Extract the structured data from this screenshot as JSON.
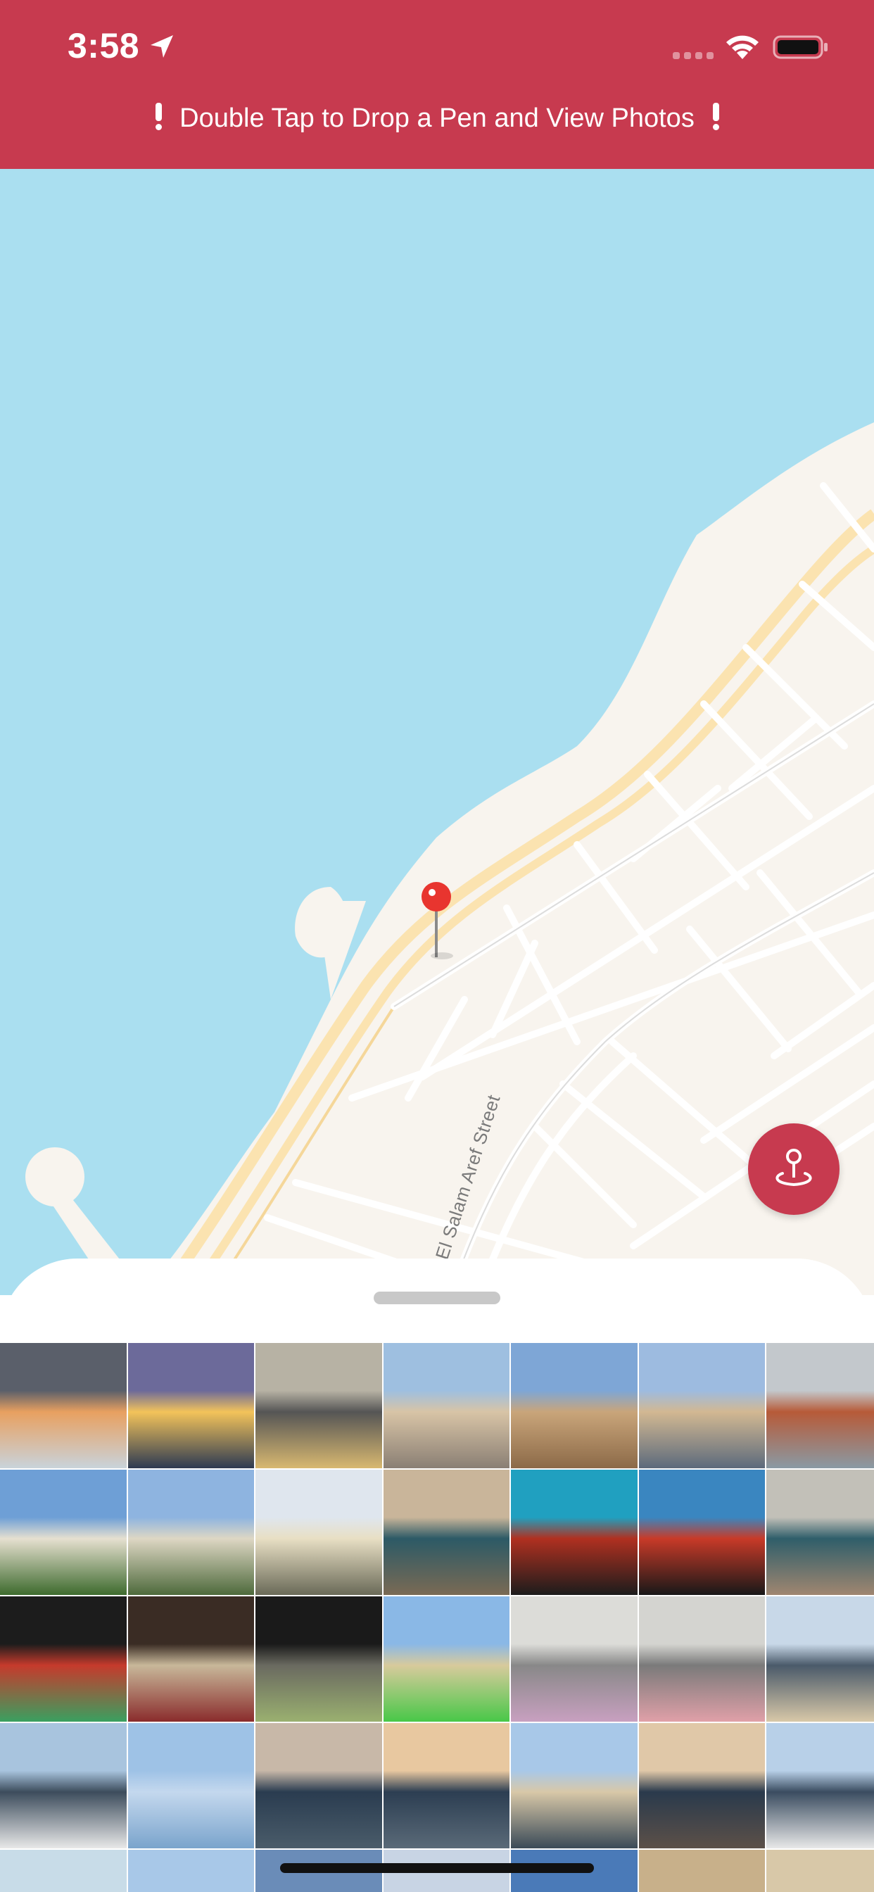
{
  "theme": {
    "accent": "#c73a4f",
    "water": "#aadff0",
    "land": "#f8f4ee",
    "road": "#ffffff",
    "highway": "#fbe3b0",
    "pin": "#e8352f"
  },
  "status_bar": {
    "time": "3:58",
    "location_icon": "location-arrow-icon",
    "wifi_icon": "wifi-icon",
    "battery_icon": "battery-icon"
  },
  "banner": {
    "text": "Double Tap to Drop a Pen and View Photos",
    "left_icon": "exclamation-icon",
    "right_icon": "exclamation-icon"
  },
  "map": {
    "street_label": "Abd El Salam Aref Street",
    "pin_icon": "map-pin-icon"
  },
  "locate_button": {
    "icon": "location-pin-icon"
  },
  "photos": [
    {
      "subject": "sea waves at dusk",
      "palette": [
        "#5a5f6a",
        "#e8a060",
        "#c9d3db"
      ]
    },
    {
      "subject": "sunset over sea",
      "palette": [
        "#6c6a9a",
        "#f3c35a",
        "#2d3a52"
      ]
    },
    {
      "subject": "corniche street",
      "palette": [
        "#b7b2a4",
        "#555555",
        "#d8b870"
      ]
    },
    {
      "subject": "apartment towers",
      "palette": [
        "#9ebfe0",
        "#d8c4a6",
        "#8a7f74"
      ]
    },
    {
      "subject": "tall buildings",
      "palette": [
        "#7ea6d6",
        "#c9a57a",
        "#8c6a48"
      ]
    },
    {
      "subject": "hotel building",
      "palette": [
        "#9dbbe0",
        "#d2b892",
        "#5c6a7c"
      ]
    },
    {
      "subject": "rain on window",
      "palette": [
        "#c3c8cc",
        "#b75a38",
        "#8a9aa4"
      ]
    },
    {
      "subject": "palace garden",
      "palette": [
        "#6e9fd6",
        "#e6e0d0",
        "#3e6b2e"
      ]
    },
    {
      "subject": "palace facade",
      "palette": [
        "#8eb4e0",
        "#ded7c4",
        "#4e6a3c"
      ]
    },
    {
      "subject": "villa facade",
      "palette": [
        "#dfe6ee",
        "#e8dfc4",
        "#6a6a58"
      ]
    },
    {
      "subject": "jewelry display",
      "palette": [
        "#c9b59a",
        "#2c5a66",
        "#7a6a54"
      ]
    },
    {
      "subject": "stained glass",
      "palette": [
        "#20a0c0",
        "#b03020",
        "#1c1c1c"
      ]
    },
    {
      "subject": "stained glass",
      "palette": [
        "#3a86c0",
        "#c83a28",
        "#181818"
      ]
    },
    {
      "subject": "jewelry display",
      "palette": [
        "#c2c0b8",
        "#2f5e6a",
        "#a08670"
      ]
    },
    {
      "subject": "stained glass",
      "palette": [
        "#1c1c1c",
        "#c63a2c",
        "#3aa060"
      ]
    },
    {
      "subject": "palace interior",
      "palette": [
        "#3a2c24",
        "#c8b89a",
        "#8a2c2c"
      ]
    },
    {
      "subject": "window interior",
      "palette": [
        "#1a1a1a",
        "#6a6a60",
        "#9ab070"
      ]
    },
    {
      "subject": "villa with toy",
      "palette": [
        "#8ab8e6",
        "#d8ca9c",
        "#48c848"
      ]
    },
    {
      "subject": "market roof",
      "palette": [
        "#dcdcd8",
        "#888888",
        "#c8a0c0"
      ]
    },
    {
      "subject": "market mural",
      "palette": [
        "#d4d4d0",
        "#7a7a7a",
        "#e0a0a8"
      ]
    },
    {
      "subject": "harbor view",
      "palette": [
        "#c8d8e8",
        "#4a5a6a",
        "#d8c8a8"
      ]
    },
    {
      "subject": "boats in bay",
      "palette": [
        "#a8c4de",
        "#3c4c5c",
        "#e8e8e8"
      ]
    },
    {
      "subject": "clear sky",
      "palette": [
        "#9ec2e6",
        "#c4d8ee",
        "#7aa4cc"
      ]
    },
    {
      "subject": "sea rocks",
      "palette": [
        "#c8b8a8",
        "#2a3c50",
        "#4a5c6a"
      ]
    },
    {
      "subject": "calm sea",
      "palette": [
        "#e8c8a0",
        "#2c3e52",
        "#5a6a78"
      ]
    },
    {
      "subject": "harbor towers",
      "palette": [
        "#a8c8e8",
        "#d8c8a8",
        "#3a4a58"
      ]
    },
    {
      "subject": "rocky shore",
      "palette": [
        "#e0c8a8",
        "#2a3a4c",
        "#5c5048"
      ]
    },
    {
      "subject": "boats on sea",
      "palette": [
        "#b8d0e8",
        "#3a4c60",
        "#e8e8e8"
      ]
    },
    {
      "subject": "beach waves",
      "palette": [
        "#c8dce8",
        "#e8e8e8",
        "#6a8a9a"
      ]
    },
    {
      "subject": "sky",
      "palette": [
        "#a8c8e8",
        "#c8dcee",
        "#7a9cc0"
      ]
    },
    {
      "subject": "city sea",
      "palette": [
        "#6a8cb8",
        "#3a3a4a",
        "#8aa0c0"
      ]
    },
    {
      "subject": "sea",
      "palette": [
        "#c8d4e4",
        "#4a6a8a",
        "#9ab0c8"
      ]
    },
    {
      "subject": "church tower",
      "palette": [
        "#4a7ab8",
        "#c84a2c",
        "#d8d0c0"
      ]
    },
    {
      "subject": "buildings",
      "palette": [
        "#c8b08a",
        "#a08c6a",
        "#e0d4bc"
      ]
    },
    {
      "subject": "buildings",
      "palette": [
        "#d8c8a8",
        "#8a7a64",
        "#ece4d4"
      ]
    }
  ]
}
